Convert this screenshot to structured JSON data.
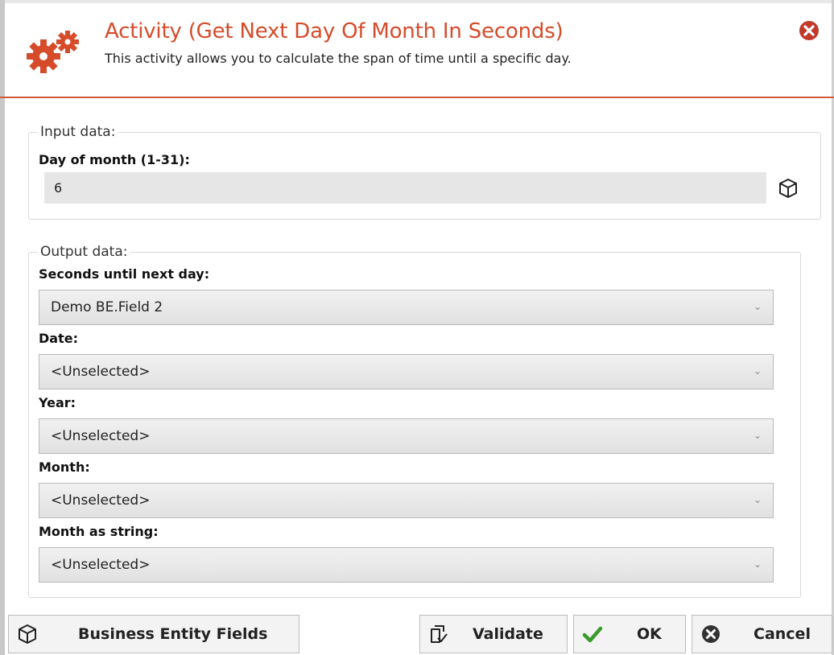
{
  "header": {
    "title": "Activity (Get Next Day Of Month In Seconds)",
    "subtitle": "This activity allows you to calculate the span of time until a specific day."
  },
  "input": {
    "legend": "Input data:",
    "day_label": "Day of month (1-31):",
    "day_value": "6"
  },
  "output": {
    "legend": "Output data:",
    "fields": [
      {
        "label": "Seconds until next day:",
        "value": "Demo BE.Field 2"
      },
      {
        "label": "Date:",
        "value": "<Unselected>"
      },
      {
        "label": "Year:",
        "value": "<Unselected>"
      },
      {
        "label": "Month:",
        "value": "<Unselected>"
      },
      {
        "label": "Month as string:",
        "value": "<Unselected>"
      }
    ]
  },
  "footer": {
    "business_entity_fields": "Business Entity Fields",
    "validate": "Validate",
    "ok": "OK",
    "cancel": "Cancel"
  },
  "colors": {
    "accent": "#d64b2a",
    "close": "#c0392b",
    "ok_check": "#3a9a2c"
  },
  "icons": [
    "gear-icon",
    "close-icon",
    "cube-icon",
    "document-check-icon",
    "checkmark-icon",
    "cancel-icon"
  ]
}
